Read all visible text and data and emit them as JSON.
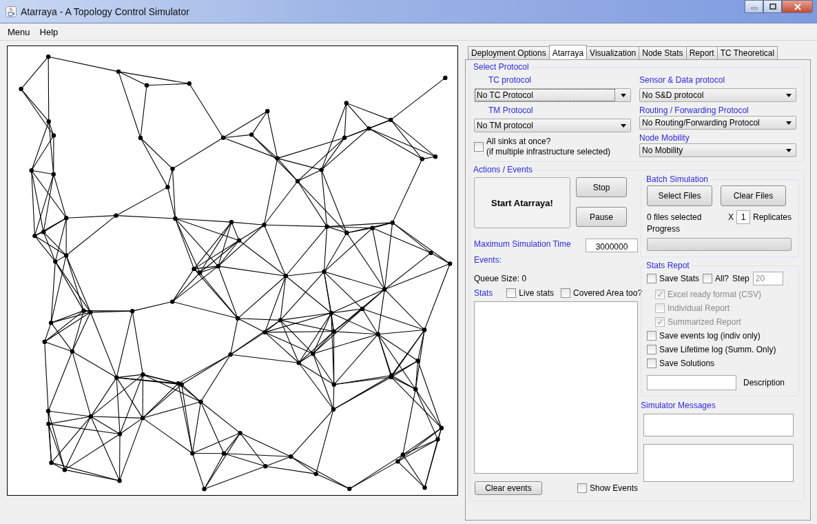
{
  "window": {
    "title": "Atarraya - A Topology Control Simulator"
  },
  "menu": [
    "Menu",
    "Help"
  ],
  "tabs": [
    {
      "label": "Deployment Options",
      "selected": false
    },
    {
      "label": "Atarraya",
      "selected": true
    },
    {
      "label": "Visualization",
      "selected": false
    },
    {
      "label": "Node Stats",
      "selected": false
    },
    {
      "label": "Report",
      "selected": false
    },
    {
      "label": "TC Theoretical",
      "selected": false
    }
  ],
  "select_protocol": {
    "title": "Select Protocol",
    "left": [
      {
        "label": "TC protocol",
        "value": "No TC Protocol",
        "focused": true
      },
      {
        "label": "TM Protocol",
        "value": "No TM protocol",
        "focused": false
      }
    ],
    "all_sinks": {
      "lines": [
        "All sinks at once?",
        "(if multiple infrastructure selected)"
      ],
      "checked": false
    },
    "right": [
      {
        "label": "Sensor & Data protocol",
        "value": "No S&D protocol",
        "focused": false
      },
      {
        "label": "Routing / Forwarding Protocol",
        "value": "No Routing/Forwarding Protocol",
        "focused": false
      },
      {
        "label": "Node Mobility",
        "value": "No Mobility",
        "focused": false
      }
    ]
  },
  "actions": {
    "title": "Actions / Events",
    "start_button": "Start Atarraya!",
    "stop_button": "Stop",
    "pause_button": "Pause",
    "max_time_label": "Maximum Simulation Time",
    "max_time_value": "3000000",
    "events_label": "Events:",
    "queue_size": "Queue Size: 0",
    "stats_label": "Stats",
    "stats_options": [
      {
        "label": "Live stats",
        "checked": false
      },
      {
        "label": "Covered Area too?",
        "checked": false
      }
    ],
    "clear_events_button": "Clear events",
    "show_events": {
      "label": "Show Events",
      "checked": false
    }
  },
  "batch": {
    "title": "Batch Simulation",
    "select_files_button": "Select Files",
    "clear_files_button": "Clear Files",
    "files_selected": "0 files selected",
    "times": "X",
    "replicates_value": "1",
    "replicates_label": "Replicates",
    "progress_label": "Progress",
    "progress": {
      "level": 0
    }
  },
  "stats_report": {
    "title": "Stats Repot",
    "save_stats": {
      "label": "Save Stats",
      "checked": false
    },
    "all": {
      "label": "All?",
      "checked": false
    },
    "step_label": "Step",
    "step_value": "20",
    "sub_options": [
      {
        "label": "Excel ready format (CSV)",
        "checked": true,
        "disabled": true
      },
      {
        "label": "Individual Report",
        "checked": false,
        "disabled": true
      },
      {
        "label": "Summarized Report",
        "checked": true,
        "disabled": true
      }
    ],
    "options": [
      {
        "label": "Save events log (indiv only)",
        "checked": false
      },
      {
        "label": "Save Lifetime log (Summ. Only)",
        "checked": false
      },
      {
        "label": "Save Solutions",
        "checked": false
      }
    ],
    "description_label": "Description"
  },
  "simulator_messages": {
    "title": "Simulator Messages"
  }
}
